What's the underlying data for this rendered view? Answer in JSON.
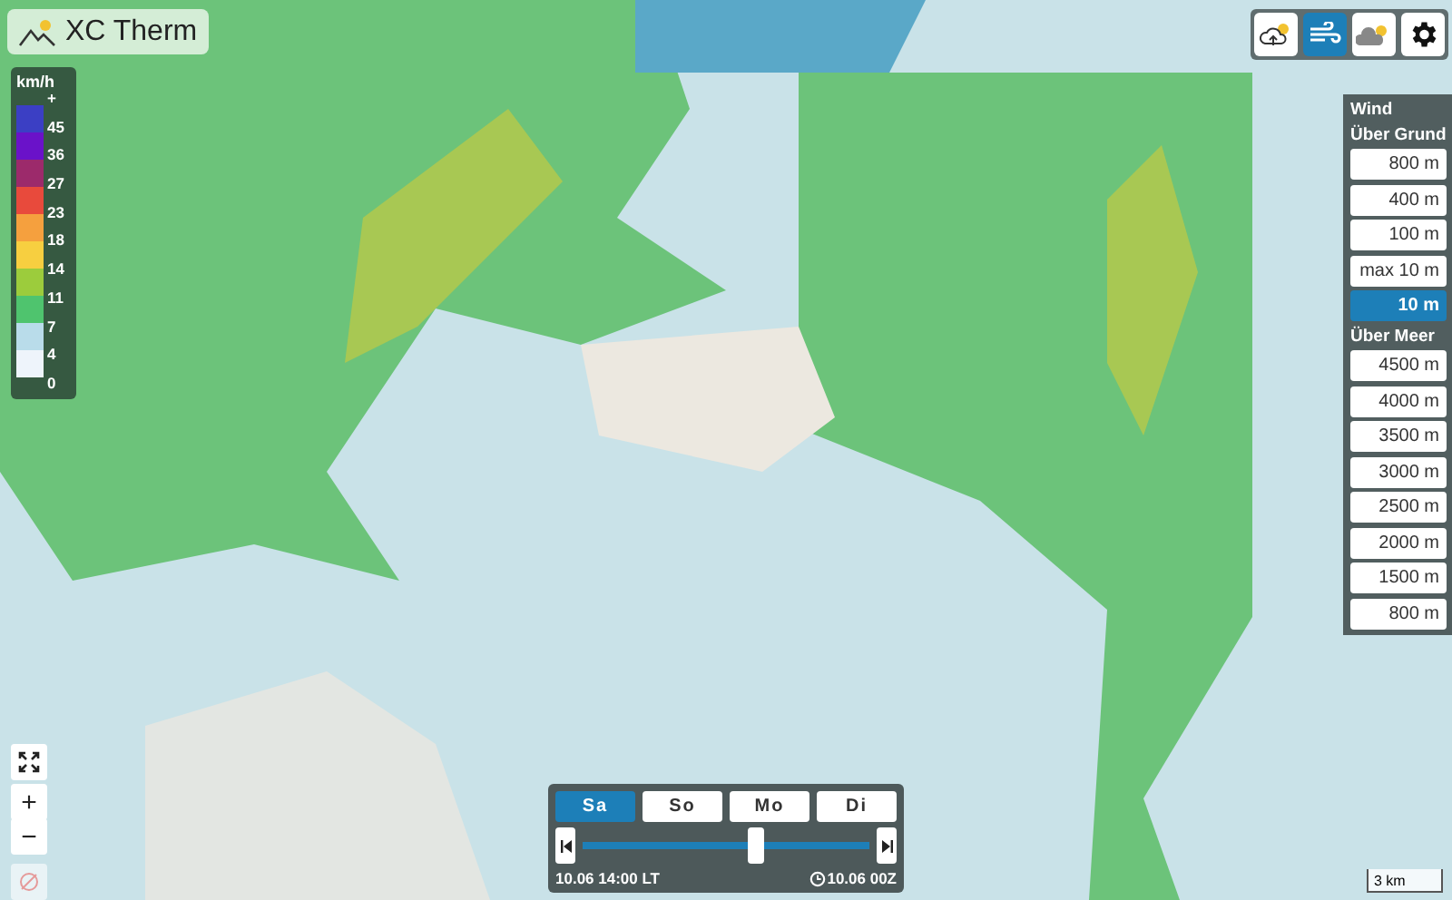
{
  "logo": {
    "title": "XC Therm"
  },
  "legend": {
    "unit": "km/h",
    "labels": [
      "+",
      "45",
      "36",
      "27",
      "23",
      "18",
      "14",
      "11",
      "7",
      "4",
      "0"
    ],
    "swatches": [
      {
        "color": "#3b3fc4"
      },
      {
        "color": "#6a12c9"
      },
      {
        "color": "#9c2a6b"
      },
      {
        "color": "#e84a3c"
      },
      {
        "color": "#f5a03e"
      },
      {
        "color": "#f7cf40"
      },
      {
        "color": "#9ccc3c"
      },
      {
        "color": "#4fc46e"
      },
      {
        "color": "#b9dcea"
      },
      {
        "color": "#eef4fb"
      }
    ]
  },
  "toolbar": [
    {
      "kind": "cloud-sun",
      "selected": false
    },
    {
      "kind": "wind",
      "selected": true
    },
    {
      "kind": "clouds",
      "selected": false
    },
    {
      "kind": "gear",
      "selected": false
    }
  ],
  "wind_panel": {
    "title": "Wind",
    "groups": [
      {
        "label": "Über Grund",
        "options": [
          {
            "label": "800 m",
            "selected": false
          },
          {
            "label": "400 m",
            "selected": false
          },
          {
            "label": "100 m",
            "selected": false
          },
          {
            "label": "max 10 m",
            "selected": false
          },
          {
            "label": "10 m",
            "selected": true
          }
        ]
      },
      {
        "label": "Über Meer",
        "options": [
          {
            "label": "4500 m",
            "selected": false
          },
          {
            "label": "4000 m",
            "selected": false
          },
          {
            "label": "3500 m",
            "selected": false
          },
          {
            "label": "3000 m",
            "selected": false
          },
          {
            "label": "2500 m",
            "selected": false
          },
          {
            "label": "2000 m",
            "selected": false
          },
          {
            "label": "1500 m",
            "selected": false
          },
          {
            "label": "800 m",
            "selected": false
          }
        ]
      }
    ]
  },
  "timeline": {
    "days": [
      {
        "label": "Sa",
        "selected": true
      },
      {
        "label": "So",
        "selected": false
      },
      {
        "label": "Mo",
        "selected": false
      },
      {
        "label": "Di",
        "selected": false
      }
    ],
    "slider": {
      "level": 0.6
    },
    "local_time": "10.06 14:00 LT",
    "model_run": "10.06 00Z"
  },
  "map_controls": {
    "zoom_in": "+",
    "zoom_out": "−",
    "location_disabled": true
  },
  "scale": "3 km"
}
